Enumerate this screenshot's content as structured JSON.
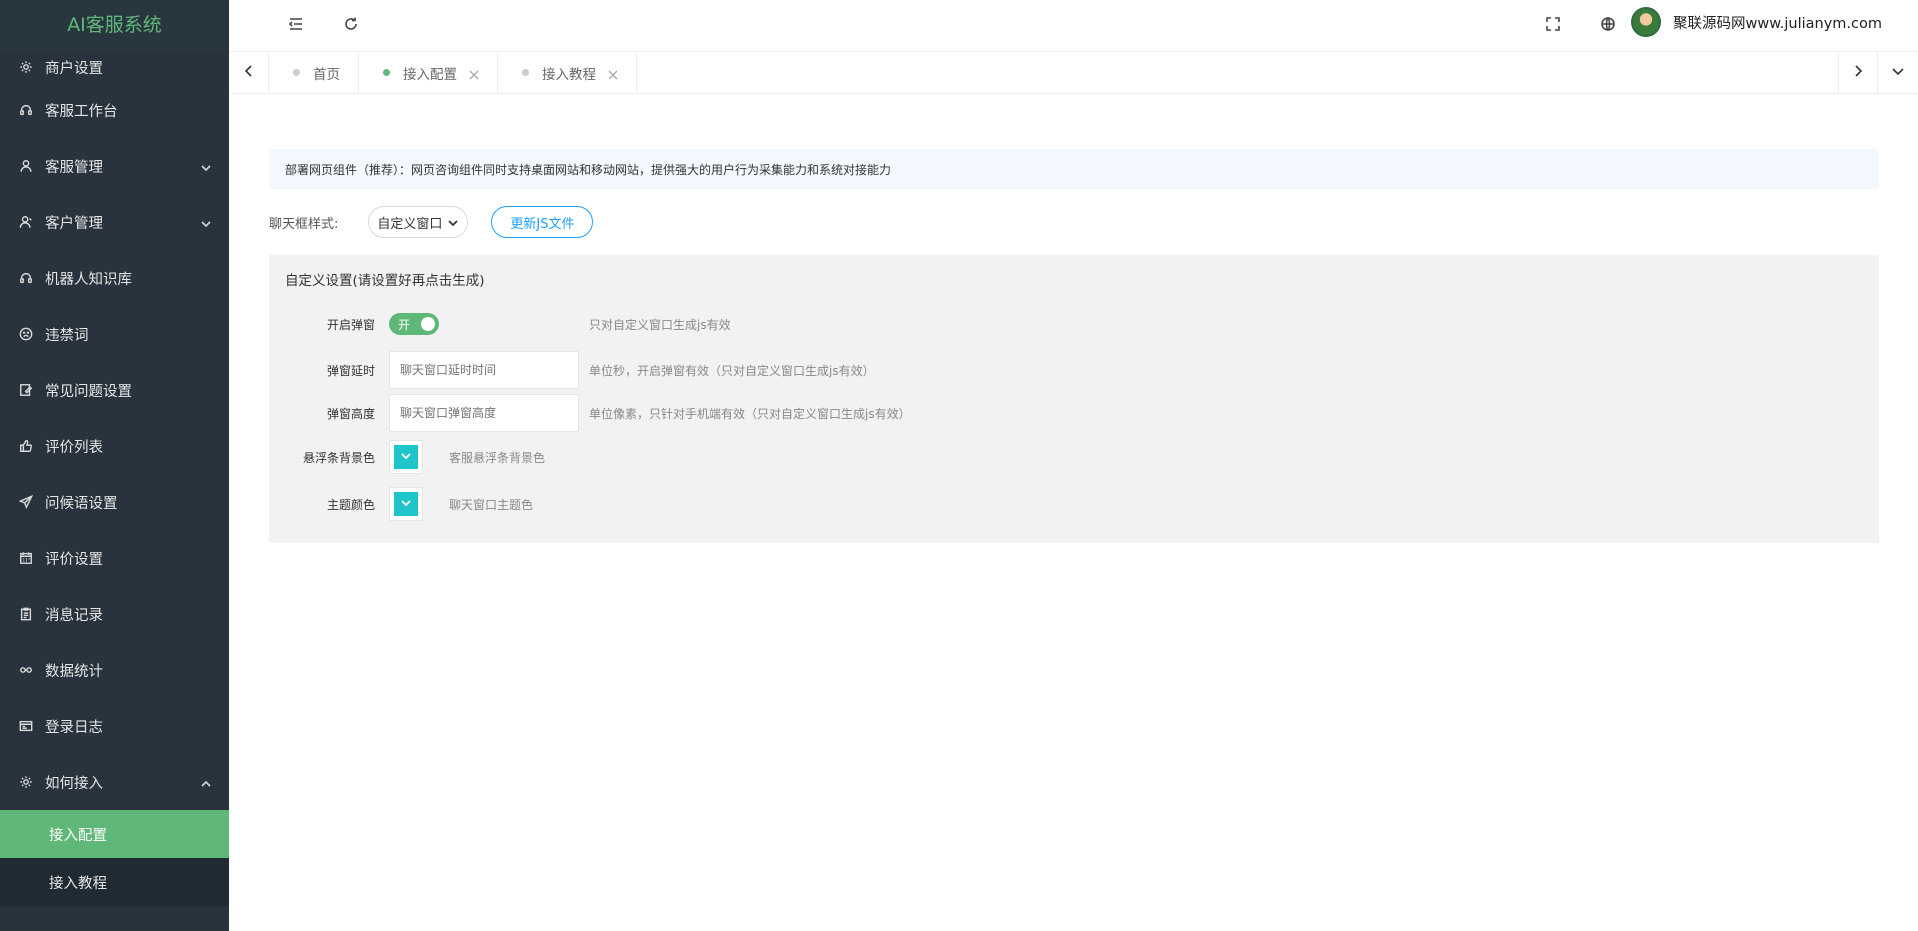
{
  "sidebar": {
    "brand": "AI客服系统",
    "items": [
      {
        "label": "商户设置",
        "icon": "gear-icon"
      },
      {
        "label": "客服工作台",
        "icon": "headset-icon"
      },
      {
        "label": "客服管理",
        "icon": "user-icon",
        "expandable": true
      },
      {
        "label": "客户管理",
        "icon": "customer-icon",
        "expandable": true
      },
      {
        "label": "机器人知识库",
        "icon": "robot-icon"
      },
      {
        "label": "违禁词",
        "icon": "frown-icon"
      },
      {
        "label": "常见问题设置",
        "icon": "edit-icon"
      },
      {
        "label": "评价列表",
        "icon": "thumbs-up-icon"
      },
      {
        "label": "问候语设置",
        "icon": "send-icon"
      },
      {
        "label": "评价设置",
        "icon": "calendar-icon"
      },
      {
        "label": "消息记录",
        "icon": "clipboard-icon"
      },
      {
        "label": "数据统计",
        "icon": "link-icon"
      },
      {
        "label": "登录日志",
        "icon": "log-icon"
      },
      {
        "label": "如何接入",
        "icon": "settings-icon",
        "expanded": true
      }
    ],
    "submenu": [
      {
        "label": "接入配置",
        "active": true
      },
      {
        "label": "接入教程",
        "active": false
      }
    ]
  },
  "header": {
    "user_name": "聚联源码网www.julianym.com",
    "icons": [
      "menu-fold-icon",
      "refresh-icon",
      "fullscreen-icon",
      "globe-icon"
    ]
  },
  "tabs": [
    {
      "label": "首页",
      "closable": false,
      "active": false
    },
    {
      "label": "接入配置",
      "closable": true,
      "active": true
    },
    {
      "label": "接入教程",
      "closable": true,
      "active": false
    }
  ],
  "content": {
    "notice": "部署网页组件（推荐）：网页咨询组件同时支持桌面网站和移动网站，提供强大的用户行为采集能力和系统对接能力",
    "style_label": "聊天框样式:",
    "style_value": "自定义窗口",
    "update_js_button": "更新JS文件",
    "panel_title": "自定义设置(请设置好再点击生成)",
    "fields": {
      "popup": {
        "label": "开启弹窗",
        "toggle_text": "开",
        "hint": "只对自定义窗口生成js有效"
      },
      "delay": {
        "label": "弹窗延时",
        "placeholder": "聊天窗口延时时间",
        "hint": "单位秒，开启弹窗有效（只对自定义窗口生成js有效）"
      },
      "height": {
        "label": "弹窗高度",
        "placeholder": "聊天窗口弹窗高度",
        "hint": "单位像素，只针对手机端有效（只对自定义窗口生成js有效）"
      },
      "float_bg": {
        "label": "悬浮条背景色",
        "color": "#1fc5c9",
        "hint": "客服悬浮条背景色"
      },
      "theme": {
        "label": "主题颜色",
        "color": "#1fc5c9",
        "hint": "聊天窗口主题色"
      }
    }
  },
  "colors": {
    "sidebar_bg": "#28333e",
    "brand_green": "#5fb878",
    "primary_blue": "#1e9fff"
  }
}
